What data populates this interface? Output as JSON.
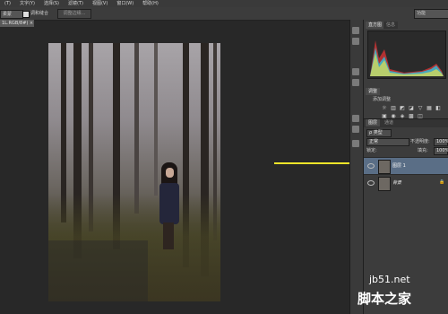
{
  "menubar": {
    "items": [
      "(T)",
      "文字(Y)",
      "选择(S)",
      "滤镜(T)",
      "视图(V)",
      "窗口(W)",
      "帮助(H)"
    ]
  },
  "options": {
    "mode_value": "柔蒙",
    "checkbox_label": "调和缝合",
    "refine_button": "调整边缘...",
    "workspace": "功能"
  },
  "document": {
    "tab_label": "1L.RGB/8#) ×"
  },
  "panels": {
    "histogram_tabs": [
      "直方图",
      "信息"
    ],
    "adjust_tab": "调整",
    "adjust_title": "添加调整",
    "layers_tabs": [
      "图层",
      "通道"
    ],
    "filter": "ρ 类型",
    "blend_mode": "正常",
    "opacity_label": "不透明度:",
    "opacity_value": "100%",
    "lock_label": "锁定:",
    "fill_label": "填充:",
    "fill_value": "100%",
    "layers": [
      {
        "name": "图层 1",
        "selected": true
      },
      {
        "name": "背景",
        "selected": false
      }
    ]
  },
  "watermark": {
    "domain": "jb51.net",
    "brand": "脚本之家"
  },
  "colors": {
    "arrow": "#f0e52a",
    "selected_layer": "#5a6e86"
  }
}
